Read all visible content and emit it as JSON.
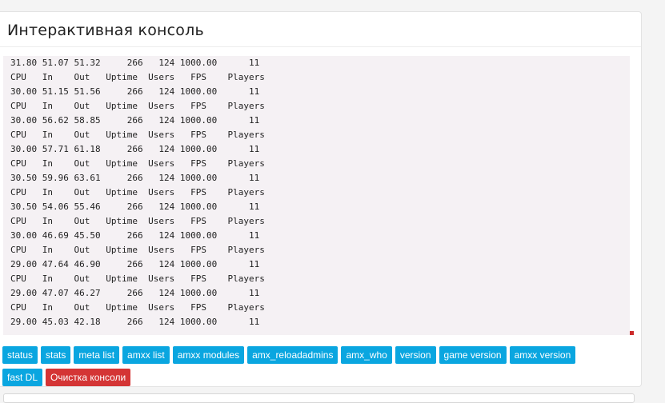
{
  "panel": {
    "title": "Интерактивная консоль"
  },
  "console": {
    "lines": [
      "31.80 51.07 51.32     266   124 1000.00      11",
      "CPU   In    Out   Uptime  Users   FPS    Players",
      "30.00 51.15 51.56     266   124 1000.00      11",
      "CPU   In    Out   Uptime  Users   FPS    Players",
      "30.00 56.62 58.85     266   124 1000.00      11",
      "CPU   In    Out   Uptime  Users   FPS    Players",
      "30.00 57.71 61.18     266   124 1000.00      11",
      "CPU   In    Out   Uptime  Users   FPS    Players",
      "30.50 59.96 63.61     266   124 1000.00      11",
      "CPU   In    Out   Uptime  Users   FPS    Players",
      "30.50 54.06 55.46     266   124 1000.00      11",
      "CPU   In    Out   Uptime  Users   FPS    Players",
      "30.00 46.69 45.50     266   124 1000.00      11",
      "CPU   In    Out   Uptime  Users   FPS    Players",
      "29.00 47.64 46.90     266   124 1000.00      11",
      "CPU   In    Out   Uptime  Users   FPS    Players",
      "29.00 47.07 46.27     266   124 1000.00      11",
      "CPU   In    Out   Uptime  Users   FPS    Players",
      "29.00 45.03 42.18     266   124 1000.00      11"
    ]
  },
  "buttons": {
    "status": "status",
    "stats": "stats",
    "meta_list": "meta list",
    "amxx_list": "amxx list",
    "amxx_modules": "amxx modules",
    "amx_reloadadmins": "amx_reloadadmins",
    "amx_who": "amx_who",
    "version": "version",
    "game_version": "game version",
    "amxx_version": "amxx version",
    "fast_dl": "fast DL",
    "clear_console": "Очистка консоли"
  },
  "colors": {
    "primary_button": "#0aa6e0",
    "danger_button": "#d43535",
    "console_bg": "#f5f1f4"
  }
}
